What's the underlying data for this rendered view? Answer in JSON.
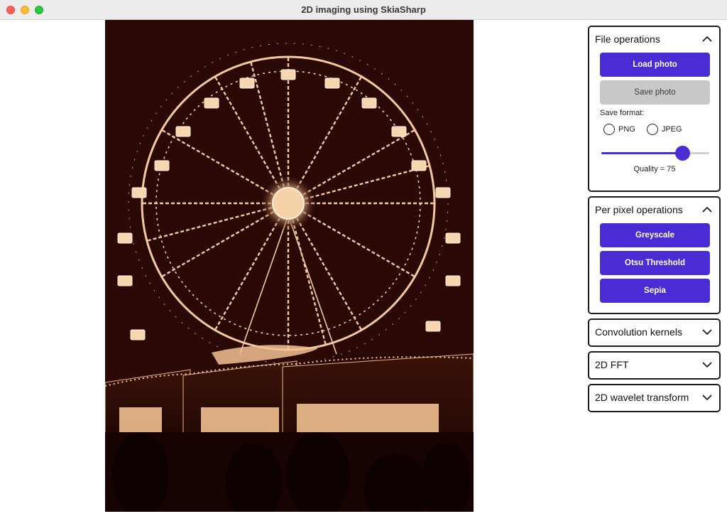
{
  "window": {
    "title": "2D imaging using SkiaSharp"
  },
  "photo": {
    "image": "sepia-ferris-wheel-photo"
  },
  "panels": {
    "file_operations": {
      "header": "File operations",
      "load_button": "Load photo",
      "save_button": "Save photo",
      "save_format_label": "Save format:",
      "format_png": "PNG",
      "format_jpeg": "JPEG",
      "quality_value": 75,
      "quality_max": 100,
      "quality_label": "Quality = 75"
    },
    "per_pixel": {
      "header": "Per pixel operations",
      "greyscale_button": "Greyscale",
      "otsu_button": "Otsu Threshold",
      "sepia_button": "Sepia"
    },
    "convolution": {
      "header": "Convolution kernels"
    },
    "fft": {
      "header": "2D FFT"
    },
    "wavelet": {
      "header": "2D wavelet transform"
    }
  },
  "colors": {
    "accent": "#4a2bd4",
    "disabled": "#c8c8c8",
    "photo_bg": "#2a0806"
  }
}
